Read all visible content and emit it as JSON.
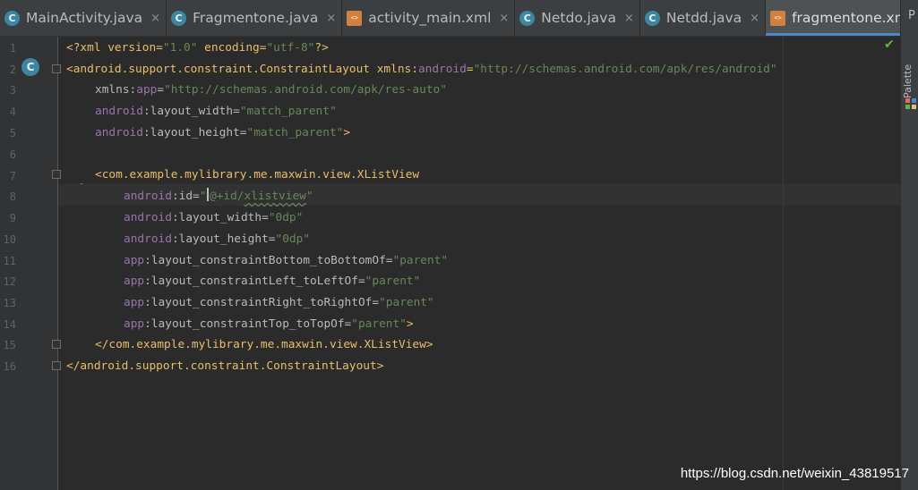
{
  "tabs": [
    {
      "label": "MainActivity.java",
      "type": "java",
      "active": false
    },
    {
      "label": "Fragmentone.java",
      "type": "java",
      "active": false
    },
    {
      "label": "activity_main.xml",
      "type": "xml",
      "active": false
    },
    {
      "label": "Netdo.java",
      "type": "java",
      "active": false
    },
    {
      "label": "Netdd.java",
      "type": "java",
      "active": false
    },
    {
      "label": "fragmentone.xml",
      "type": "xml",
      "active": true
    }
  ],
  "tab_close_glyph": "×",
  "right_panel": {
    "palette_label": "Palette",
    "top_label": "P"
  },
  "line_numbers": [
    "1",
    "2",
    "3",
    "4",
    "5",
    "6",
    "7",
    "8",
    "9",
    "10",
    "11",
    "12",
    "13",
    "14",
    "15",
    "16"
  ],
  "code": {
    "l1": {
      "a": "<?xml version=",
      "b": "\"1.0\"",
      "c": " encoding=",
      "d": "\"utf-8\"",
      "e": "?>"
    },
    "l2": {
      "tag": "<android.support.constraint.ConstraintLayout ",
      "ns": "xmlns:",
      "nsn": "android",
      "eq": "=",
      "val": "\"http://schemas.android.com/apk/res/android\""
    },
    "l3": {
      "ns": "xmlns:",
      "nsn": "app",
      "eq": "=",
      "val": "\"http://schemas.android.com/apk/res-auto\""
    },
    "l4": {
      "ns": "android",
      "attr": ":layout_width=",
      "val": "\"match_parent\""
    },
    "l5": {
      "ns": "android",
      "attr": ":layout_height=",
      "val": "\"match_parent\"",
      "end": ">"
    },
    "l7": {
      "tag": "<com.example.mylibrary.me.maxwin.view.XListView"
    },
    "l8": {
      "ns": "android",
      "attr": ":id=",
      "q": "\"",
      "val1": "@+id/",
      "val2": "xlistview",
      "q2": "\""
    },
    "l9": {
      "ns": "android",
      "attr": ":layout_width=",
      "val": "\"0dp\""
    },
    "l10": {
      "ns": "android",
      "attr": ":layout_height=",
      "val": "\"0dp\""
    },
    "l11": {
      "ns": "app",
      "attr": ":layout_constraintBottom_toBottomOf=",
      "val": "\"parent\""
    },
    "l12": {
      "ns": "app",
      "attr": ":layout_constraintLeft_toLeftOf=",
      "val": "\"parent\""
    },
    "l13": {
      "ns": "app",
      "attr": ":layout_constraintRight_toRightOf=",
      "val": "\"parent\""
    },
    "l14": {
      "ns": "app",
      "attr": ":layout_constraintTop_toTopOf=",
      "val": "\"parent\"",
      "end": ">"
    },
    "l15": {
      "tag": "</com.example.mylibrary.me.maxwin.view.XListView>"
    },
    "l16": {
      "tag": "</android.support.constraint.ConstraintLayout>"
    }
  },
  "gutter_class_marker": "C",
  "watermark": "https://blog.csdn.net/weixin_43819517",
  "colors": {
    "tag": "#e8bf6a",
    "namespace": "#9876aa",
    "value": "#6a8759",
    "attr": "#bababa",
    "background": "#2b2b2b"
  }
}
